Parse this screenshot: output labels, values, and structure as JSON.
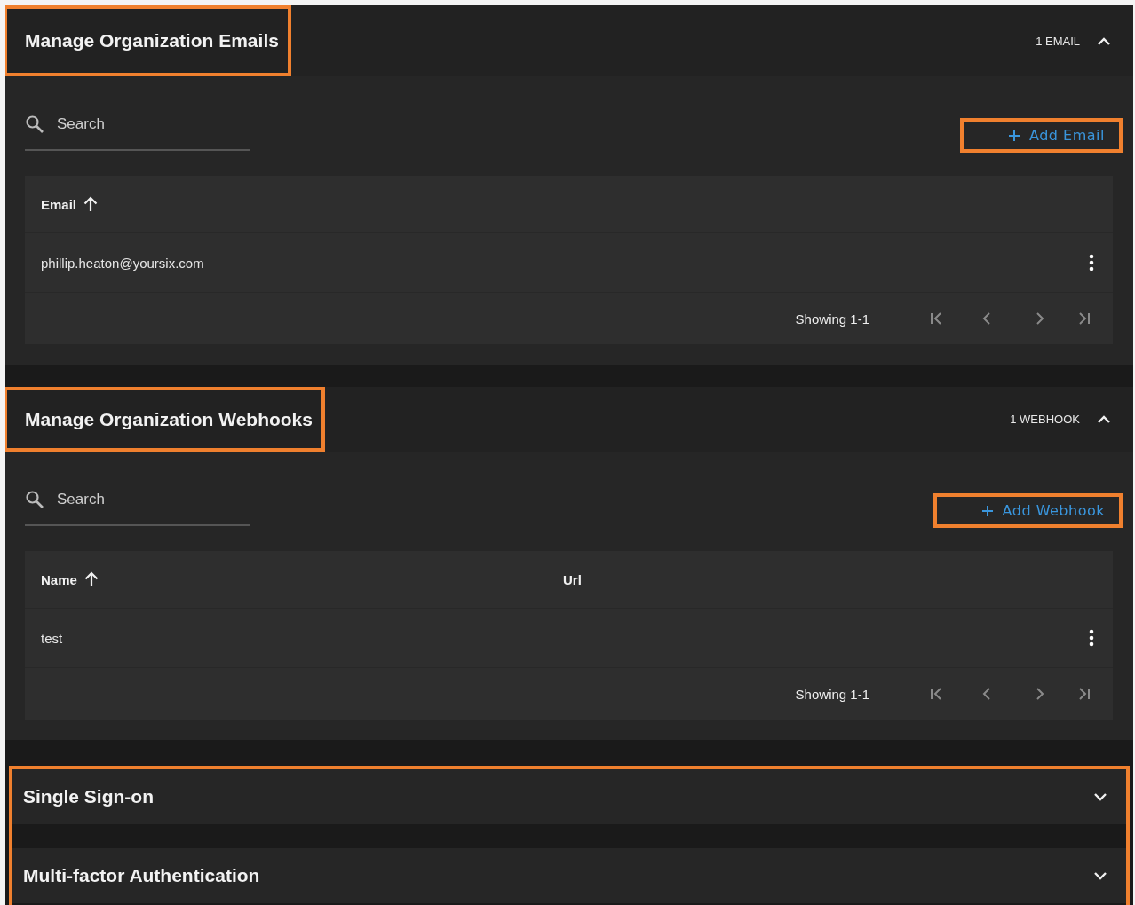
{
  "sections": [
    {
      "title": "Manage Organization Emails",
      "count": "1 EMAIL",
      "expanded": true,
      "highlighted": true,
      "search": {
        "placeholder": "Search"
      },
      "add_button": {
        "label": "Add Email",
        "highlighted": true
      },
      "table": {
        "columns": [
          {
            "label": "Email",
            "sorted": true
          }
        ],
        "rows": [
          [
            "phillip.heaton@yoursix.com"
          ]
        ],
        "pagination": "Showing 1-1"
      }
    },
    {
      "title": "Manage Organization Webhooks",
      "count": "1 WEBHOOK",
      "expanded": true,
      "highlighted": true,
      "search": {
        "placeholder": "Search"
      },
      "add_button": {
        "label": "Add Webhook",
        "highlighted": true
      },
      "table": {
        "columns": [
          {
            "label": "Name",
            "sorted": true
          },
          {
            "label": "Url",
            "sorted": false
          }
        ],
        "rows": [
          [
            "test"
          ]
        ],
        "pagination": "Showing 1-1"
      }
    }
  ],
  "collapsed_group": {
    "highlighted": true,
    "sections": [
      {
        "title": "Single Sign-on",
        "expanded": false
      },
      {
        "title": "Multi-factor Authentication",
        "expanded": false
      }
    ]
  }
}
